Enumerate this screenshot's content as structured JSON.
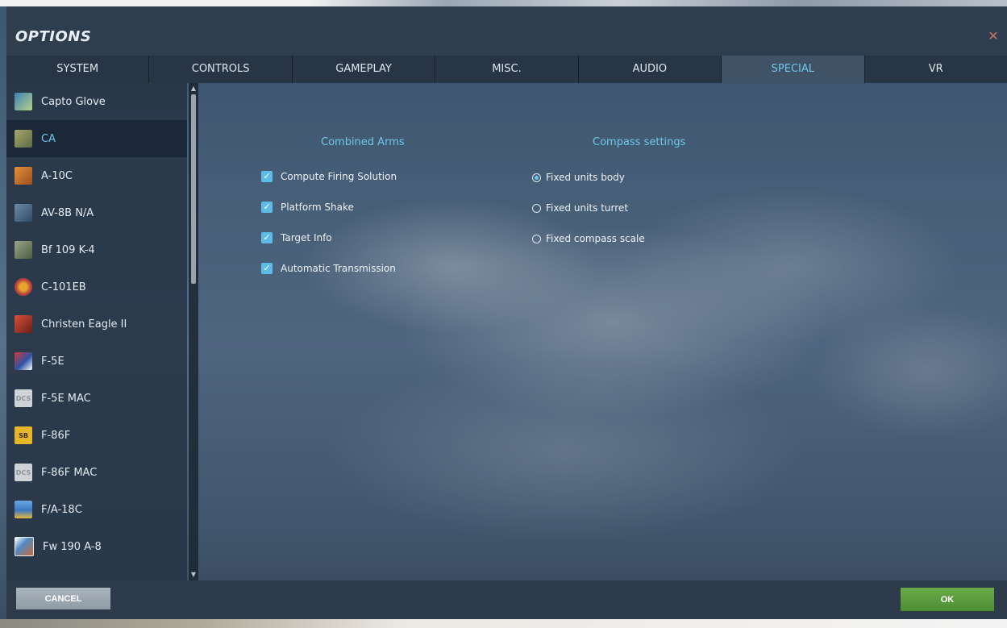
{
  "window": {
    "title": "OPTIONS",
    "close_icon": "close-icon",
    "close_symbol": "✕"
  },
  "tabs": [
    {
      "label": "SYSTEM",
      "active": false
    },
    {
      "label": "CONTROLS",
      "active": false
    },
    {
      "label": "GAMEPLAY",
      "active": false
    },
    {
      "label": "MISC.",
      "active": false
    },
    {
      "label": "AUDIO",
      "active": false
    },
    {
      "label": "SPECIAL",
      "active": true
    },
    {
      "label": "VR",
      "active": false
    }
  ],
  "sidebar": {
    "items": [
      {
        "label": "Capto Glove",
        "icon": "capto-glove-icon",
        "icon_color": "#5a8fbf",
        "active": false
      },
      {
        "label": "CA",
        "icon": "combined-arms-icon",
        "icon_color": "#8a8f5a",
        "active": true
      },
      {
        "label": "A-10C",
        "icon": "a10c-icon",
        "icon_color": "#d2782e",
        "active": false
      },
      {
        "label": "AV-8B N/A",
        "icon": "av8b-icon",
        "icon_color": "#5c7a96",
        "active": false
      },
      {
        "label": "Bf 109 K-4",
        "icon": "bf109-icon",
        "icon_color": "#7d8d6e",
        "active": false
      },
      {
        "label": "C-101EB",
        "icon": "c101-icon",
        "icon_color": "#b9403a",
        "active": false
      },
      {
        "label": "Christen Eagle II",
        "icon": "christen-eagle-icon",
        "icon_color": "#b83a2c",
        "active": false
      },
      {
        "label": "F-5E",
        "icon": "f5e-icon",
        "icon_color": "#2e52a6",
        "active": false
      },
      {
        "label": "F-5E MAC",
        "icon": "dcs-logo-icon",
        "icon_color": "#d0d3d6",
        "active": false
      },
      {
        "label": "F-86F",
        "icon": "f86f-icon",
        "icon_color": "#e7b628",
        "active": false
      },
      {
        "label": "F-86F MAC",
        "icon": "dcs-logo-icon",
        "icon_color": "#d0d3d6",
        "active": false
      },
      {
        "label": "F/A-18C",
        "icon": "fa18c-hornet-icon",
        "icon_color": "#3c78c0",
        "active": false
      },
      {
        "label": "Fw 190 A-8",
        "icon": "fw190-icon",
        "icon_color": "#c86a3a",
        "active": false
      }
    ]
  },
  "content": {
    "combined_arms": {
      "title": "Combined Arms",
      "options": [
        {
          "label": "Compute Firing Solution",
          "checked": true
        },
        {
          "label": "Platform Shake",
          "checked": true
        },
        {
          "label": "Target Info",
          "checked": true
        },
        {
          "label": "Automatic Transmission",
          "checked": true
        }
      ]
    },
    "compass": {
      "title": "Compass settings",
      "options": [
        {
          "label": "Fixed units body",
          "selected": true
        },
        {
          "label": "Fixed units turret",
          "selected": false
        },
        {
          "label": "Fixed compass scale",
          "selected": false
        }
      ]
    }
  },
  "footer": {
    "cancel_label": "CANCEL",
    "ok_label": "OK"
  },
  "colors": {
    "accent": "#6ec7ea",
    "ok_green": "#5a9c3c",
    "cancel_gray": "#9aa5af",
    "close_orange": "#c9735a"
  }
}
